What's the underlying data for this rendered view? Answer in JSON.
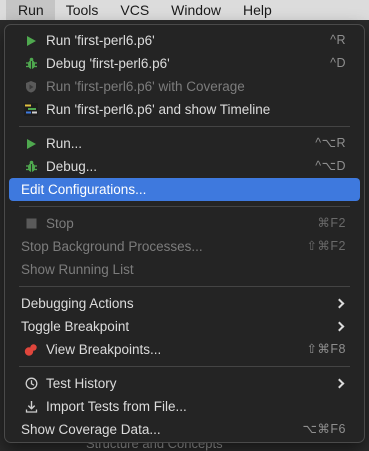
{
  "menubar": {
    "items": [
      {
        "label": "Run",
        "active": true
      },
      {
        "label": "Tools"
      },
      {
        "label": "VCS"
      },
      {
        "label": "Window"
      },
      {
        "label": "Help"
      }
    ]
  },
  "background_text": "Structure and Concepts",
  "run_menu": {
    "groups": [
      [
        {
          "label": "Run 'first-perl6.p6'",
          "shortcut": "^R",
          "icon": "run-icon",
          "enabled": true
        },
        {
          "label": "Debug 'first-perl6.p6'",
          "shortcut": "^D",
          "icon": "debug-bug-icon",
          "enabled": true
        },
        {
          "label": "Run 'first-perl6.p6' with Coverage",
          "shortcut": "",
          "icon": "coverage-icon",
          "enabled": false
        },
        {
          "label": "Run 'first-perl6.p6' and show Timeline",
          "shortcut": "",
          "icon": "timeline-icon",
          "enabled": true
        }
      ],
      [
        {
          "label": "Run...",
          "shortcut": "^⌥R",
          "icon": "run-icon",
          "enabled": true
        },
        {
          "label": "Debug...",
          "shortcut": "^⌥D",
          "icon": "debug-bug-icon",
          "enabled": true
        },
        {
          "label": "Edit Configurations...",
          "shortcut": "",
          "icon": "",
          "enabled": true,
          "highlighted": true
        }
      ],
      [
        {
          "label": "Stop",
          "shortcut": "⌘F2",
          "icon": "stop-icon",
          "enabled": false
        },
        {
          "label": "Stop Background Processes...",
          "shortcut": "⇧⌘F2",
          "icon": "",
          "enabled": false
        },
        {
          "label": "Show Running List",
          "shortcut": "",
          "icon": "",
          "enabled": false
        }
      ],
      [
        {
          "label": "Debugging Actions",
          "submenu": true,
          "icon": "",
          "enabled": true
        },
        {
          "label": "Toggle Breakpoint",
          "submenu": true,
          "icon": "",
          "enabled": true
        },
        {
          "label": "View Breakpoints...",
          "shortcut": "⇧⌘F8",
          "icon": "breakpoints-icon",
          "enabled": true
        }
      ],
      [
        {
          "label": "Test History",
          "submenu": true,
          "icon": "history-icon",
          "enabled": true
        },
        {
          "label": "Import Tests from File...",
          "shortcut": "",
          "icon": "import-icon",
          "enabled": true
        },
        {
          "label": "Show Coverage Data...",
          "shortcut": "⌥⌘F6",
          "icon": "",
          "enabled": true
        }
      ]
    ]
  },
  "colors": {
    "run_green": "#4fa84f",
    "debug_green": "#4fa84f",
    "highlight_blue": "#3e79de",
    "breakpoint_red": "#e0463c"
  }
}
